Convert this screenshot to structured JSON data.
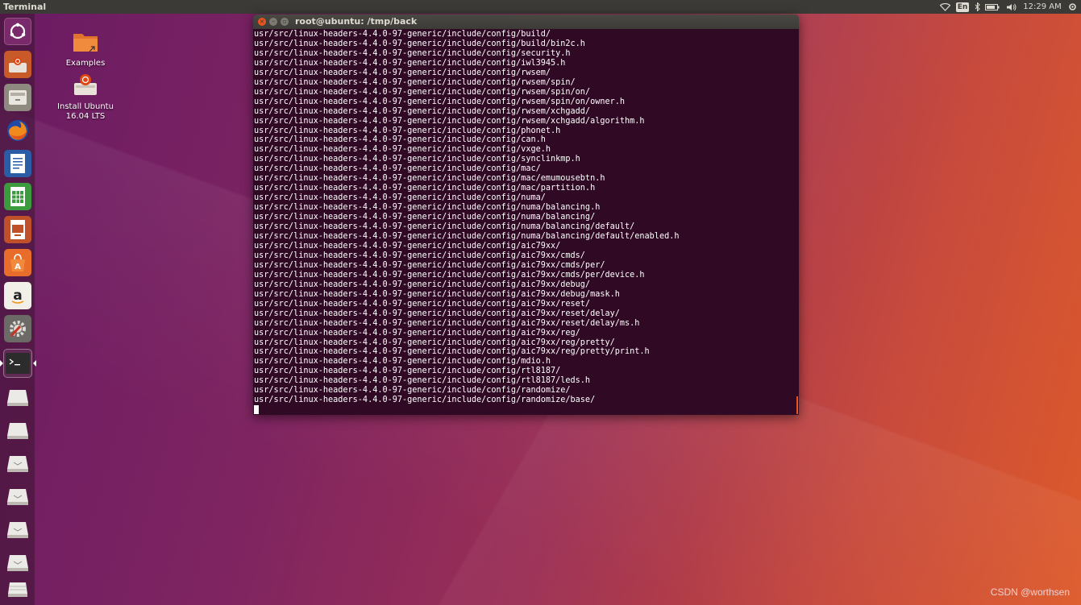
{
  "top_panel": {
    "app_title": "Terminal",
    "language": "En",
    "clock": "12:29 AM"
  },
  "launcher": {
    "items": [
      {
        "name": "dash-home-icon"
      },
      {
        "name": "install-ubuntu-icon"
      },
      {
        "name": "files-icon"
      },
      {
        "name": "firefox-icon"
      },
      {
        "name": "libreoffice-writer-icon"
      },
      {
        "name": "libreoffice-calc-icon"
      },
      {
        "name": "libreoffice-impress-icon"
      },
      {
        "name": "software-center-icon"
      },
      {
        "name": "amazon-icon"
      },
      {
        "name": "system-settings-icon"
      },
      {
        "name": "terminal-icon"
      },
      {
        "name": "drive-icon"
      },
      {
        "name": "drive-icon"
      },
      {
        "name": "drive-icon"
      },
      {
        "name": "drive-icon"
      },
      {
        "name": "drive-icon"
      },
      {
        "name": "drive-icon"
      },
      {
        "name": "trash-icon"
      }
    ]
  },
  "desktop": {
    "examples_label": "Examples",
    "install_label_line1": "Install Ubuntu",
    "install_label_line2": "16.04 LTS"
  },
  "terminal": {
    "title": "root@ubuntu: /tmp/back",
    "lines": [
      "usr/src/linux-headers-4.4.0-97-generic/include/config/build/",
      "usr/src/linux-headers-4.4.0-97-generic/include/config/build/bin2c.h",
      "usr/src/linux-headers-4.4.0-97-generic/include/config/security.h",
      "usr/src/linux-headers-4.4.0-97-generic/include/config/iwl3945.h",
      "usr/src/linux-headers-4.4.0-97-generic/include/config/rwsem/",
      "usr/src/linux-headers-4.4.0-97-generic/include/config/rwsem/spin/",
      "usr/src/linux-headers-4.4.0-97-generic/include/config/rwsem/spin/on/",
      "usr/src/linux-headers-4.4.0-97-generic/include/config/rwsem/spin/on/owner.h",
      "usr/src/linux-headers-4.4.0-97-generic/include/config/rwsem/xchgadd/",
      "usr/src/linux-headers-4.4.0-97-generic/include/config/rwsem/xchgadd/algorithm.h",
      "usr/src/linux-headers-4.4.0-97-generic/include/config/phonet.h",
      "usr/src/linux-headers-4.4.0-97-generic/include/config/can.h",
      "usr/src/linux-headers-4.4.0-97-generic/include/config/vxge.h",
      "usr/src/linux-headers-4.4.0-97-generic/include/config/synclinkmp.h",
      "usr/src/linux-headers-4.4.0-97-generic/include/config/mac/",
      "usr/src/linux-headers-4.4.0-97-generic/include/config/mac/emumousebtn.h",
      "usr/src/linux-headers-4.4.0-97-generic/include/config/mac/partition.h",
      "usr/src/linux-headers-4.4.0-97-generic/include/config/numa/",
      "usr/src/linux-headers-4.4.0-97-generic/include/config/numa/balancing.h",
      "usr/src/linux-headers-4.4.0-97-generic/include/config/numa/balancing/",
      "usr/src/linux-headers-4.4.0-97-generic/include/config/numa/balancing/default/",
      "usr/src/linux-headers-4.4.0-97-generic/include/config/numa/balancing/default/enabled.h",
      "usr/src/linux-headers-4.4.0-97-generic/include/config/aic79xx/",
      "usr/src/linux-headers-4.4.0-97-generic/include/config/aic79xx/cmds/",
      "usr/src/linux-headers-4.4.0-97-generic/include/config/aic79xx/cmds/per/",
      "usr/src/linux-headers-4.4.0-97-generic/include/config/aic79xx/cmds/per/device.h",
      "usr/src/linux-headers-4.4.0-97-generic/include/config/aic79xx/debug/",
      "usr/src/linux-headers-4.4.0-97-generic/include/config/aic79xx/debug/mask.h",
      "usr/src/linux-headers-4.4.0-97-generic/include/config/aic79xx/reset/",
      "usr/src/linux-headers-4.4.0-97-generic/include/config/aic79xx/reset/delay/",
      "usr/src/linux-headers-4.4.0-97-generic/include/config/aic79xx/reset/delay/ms.h",
      "usr/src/linux-headers-4.4.0-97-generic/include/config/aic79xx/reg/",
      "usr/src/linux-headers-4.4.0-97-generic/include/config/aic79xx/reg/pretty/",
      "usr/src/linux-headers-4.4.0-97-generic/include/config/aic79xx/reg/pretty/print.h",
      "usr/src/linux-headers-4.4.0-97-generic/include/config/mdio.h",
      "usr/src/linux-headers-4.4.0-97-generic/include/config/rtl8187/",
      "usr/src/linux-headers-4.4.0-97-generic/include/config/rtl8187/leds.h",
      "usr/src/linux-headers-4.4.0-97-generic/include/config/randomize/",
      "usr/src/linux-headers-4.4.0-97-generic/include/config/randomize/base/"
    ]
  },
  "watermark": "CSDN @worthsen",
  "colors": {
    "terminal_bg": "#300a24",
    "accent_orange": "#e9541f",
    "panel_bg": "#3b3a36"
  }
}
